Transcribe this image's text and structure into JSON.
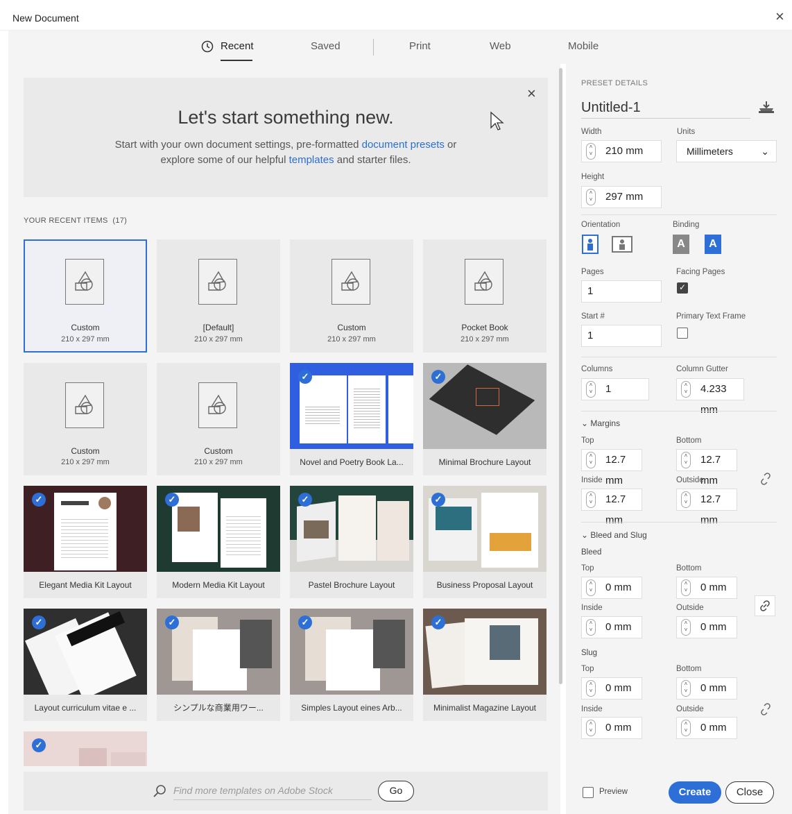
{
  "window": {
    "title": "New Document",
    "close_glyph": "×"
  },
  "tabs": [
    {
      "label": "Recent",
      "active": true,
      "icon": "clock-icon"
    },
    {
      "label": "Saved"
    },
    {
      "label": "Print"
    },
    {
      "label": "Web"
    },
    {
      "label": "Mobile"
    }
  ],
  "welcome": {
    "title": "Let's start something new.",
    "line1_pre": "Start with your own document settings, pre-formatted ",
    "line1_link": "document presets",
    "line1_post": " or",
    "line2_pre": "explore some of our helpful ",
    "line2_link": "templates",
    "line2_post": " and starter files.",
    "close_glyph": "×"
  },
  "recent": {
    "header": "YOUR RECENT ITEMS",
    "count": "(17)",
    "presets": [
      {
        "name": "Custom",
        "size": "210 x 297 mm",
        "selected": true
      },
      {
        "name": "[Default]",
        "size": "210 x 297 mm"
      },
      {
        "name": "Custom",
        "size": "210 x 297 mm"
      },
      {
        "name": "Pocket Book",
        "size": "210 x 297 mm"
      },
      {
        "name": "Custom",
        "size": "210 x 297 mm"
      },
      {
        "name": "Custom",
        "size": "210 x 297 mm"
      }
    ],
    "templates": [
      "Novel and Poetry Book La...",
      "Minimal Brochure Layout",
      "Elegant Media Kit Layout",
      "Modern Media Kit Layout",
      "Pastel Brochure Layout",
      "Business Proposal Layout",
      "Layout curriculum vitae e ...",
      "シンプルな商業用ワー...",
      "Simples Layout eines Arb...",
      "Minimalist Magazine Layout"
    ]
  },
  "stock": {
    "placeholder": "Find more templates on Adobe Stock",
    "go_label": "Go"
  },
  "preset": {
    "header": "PRESET DETAILS",
    "name": "Untitled-1",
    "width_label": "Width",
    "width": "210 mm",
    "units_label": "Units",
    "units": "Millimeters",
    "height_label": "Height",
    "height": "297 mm",
    "orientation_label": "Orientation",
    "binding_label": "Binding",
    "pages_label": "Pages",
    "pages": "1",
    "facing_label": "Facing Pages",
    "facing_checked": true,
    "start_label": "Start #",
    "start": "1",
    "primary_label": "Primary Text Frame",
    "primary_checked": false,
    "columns_label": "Columns",
    "columns": "1",
    "gutter_label": "Column Gutter",
    "gutter": "4.233 mm",
    "margins_label": "Margins",
    "margins": {
      "top_label": "Top",
      "top": "12.7 mm",
      "bottom_label": "Bottom",
      "bottom": "12.7 mm",
      "inside_label": "Inside",
      "inside": "12.7 mm",
      "outside_label": "Outside",
      "outside": "12.7 mm"
    },
    "bleedslug_label": "Bleed and Slug",
    "bleed_label": "Bleed",
    "bleed": {
      "top_label": "Top",
      "top": "0 mm",
      "bottom_label": "Bottom",
      "bottom": "0 mm",
      "inside_label": "Inside",
      "inside": "0 mm",
      "outside_label": "Outside",
      "outside": "0 mm"
    },
    "slug_label": "Slug",
    "slug": {
      "top_label": "Top",
      "top": "0 mm",
      "bottom_label": "Bottom",
      "bottom": "0 mm",
      "inside_label": "Inside",
      "inside": "0 mm",
      "outside_label": "Outside",
      "outside": "0 mm"
    },
    "preview_label": "Preview",
    "create_label": "Create",
    "close_label": "Close"
  },
  "colors": {
    "accent": "#2d6fd6",
    "panel": "#f4f4f4"
  }
}
